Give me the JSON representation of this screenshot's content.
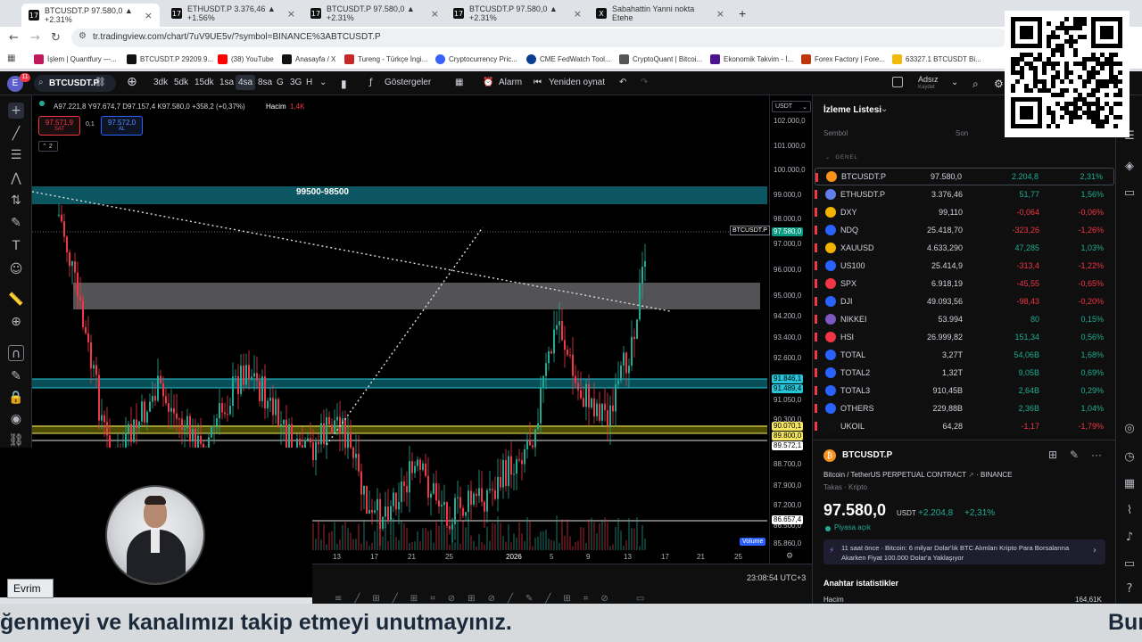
{
  "browser": {
    "tabs": [
      {
        "label": "BTCUSDT.P 97.580,0 ▲ +2.31%",
        "active": true
      },
      {
        "label": "ETHUSDT.P 3.376,46 ▲ +1.56%",
        "active": false
      },
      {
        "label": "BTCUSDT.P 97.580,0 ▲ +2.31%",
        "active": false
      },
      {
        "label": "BTCUSDT.P 97.580,0 ▲ +2.31%",
        "active": false
      },
      {
        "label": "Sabahattin Yanni nokta Etehe",
        "active": false
      }
    ],
    "url": "tr.tradingview.com/chart/7uV9UE5v/?symbol=BINANCE%3ABTCUSDT.P",
    "bookmarks": [
      "İşlem | Quantfury —...",
      "BTCUSDT.P 29209.9...",
      "(38) YouTube",
      "Anasayfa / X",
      "Tureng - Türkçe İngi...",
      "Cryptocurrency Pric...",
      "CME FedWatch Tool...",
      "CryptoQuant | Bitcoi...",
      "Ekonomik Takvim - İ...",
      "Forex Factory | Fore...",
      "63327.1 BTCUSDT Bi..."
    ]
  },
  "toolbar": {
    "symbol": "BTCUSDT.P",
    "intervals": [
      "3dk",
      "5dk",
      "15dk",
      "1sa",
      "4sa",
      "8sa",
      "G",
      "3G",
      "H"
    ],
    "active_interval": "4sa",
    "indicators": "Göstergeler",
    "alert": "Alarm",
    "replay": "Yeniden oynat",
    "user": "Adsız",
    "saved": "Kaydet",
    "avatar": "E",
    "badge": "11"
  },
  "legend": {
    "ohlc": "A97.221,8 Y97.674,7 D97.157,4 K97.580,0 +358,2 (+0,37%)",
    "volume_label": "Hacim",
    "volume_value": "1,4K",
    "sell_price": "97.571,9",
    "sell_label": "SAT",
    "spread": "0,1",
    "buy_price": "97.572,0",
    "buy_label": "AL",
    "collapse_count": "2"
  },
  "chart": {
    "zone_label": "99500-98500",
    "volume_tag": "Volume",
    "currency": "USDT",
    "price_labels": [
      "102.000,0",
      "101.000,0",
      "100.000,0",
      "99.000,0",
      "98.000,0",
      "97.000,0",
      "96.000,0",
      "95.000,0",
      "94.200,0",
      "93.400,0",
      "92.600,0",
      "91.050,0",
      "90.300,0",
      "88.700,0",
      "87.900,0",
      "87.200,0",
      "86.500,0",
      "85.860,0"
    ],
    "tags": {
      "symbol": "BTCUSDT.P",
      "last": "97.580,0",
      "a": "91.846,1",
      "b": "91.489,4",
      "c": "90.070,1",
      "d": "89.800,0",
      "e": "89.572,1",
      "f": "86.657,4"
    },
    "time_labels": [
      "13",
      "17",
      "21",
      "25",
      "2026",
      "5",
      "9",
      "13",
      "17",
      "21",
      "25"
    ],
    "clock": "23:08:54 UTC+3"
  },
  "webcam": {
    "name": "Evrim"
  },
  "watchlist": {
    "title": "İzleme Listesi",
    "col_symbol": "Sembol",
    "col_last": "Son",
    "section": "GENEL",
    "rows": [
      {
        "sym": "BTCUSDT.P",
        "last": "97.580,0",
        "chg": "2.204,8",
        "pct": "2,31%",
        "dir": "pos",
        "color": "#f7931a"
      },
      {
        "sym": "ETHUSDT.P",
        "last": "3.376,46",
        "chg": "51,77",
        "pct": "1,56%",
        "dir": "pos",
        "color": "#627eea"
      },
      {
        "sym": "DXY",
        "last": "99,110",
        "chg": "-0,064",
        "pct": "-0,06%",
        "dir": "neg",
        "color": "#f5b400"
      },
      {
        "sym": "NDQ",
        "last": "25.418,70",
        "chg": "-323,26",
        "pct": "-1,26%",
        "dir": "neg",
        "color": "#2962ff"
      },
      {
        "sym": "XAUUSD",
        "last": "4.633,290",
        "chg": "47,285",
        "pct": "1,03%",
        "dir": "pos",
        "color": "#f5b400"
      },
      {
        "sym": "US100",
        "last": "25.414,9",
        "chg": "-313,4",
        "pct": "-1,22%",
        "dir": "neg",
        "color": "#2962ff"
      },
      {
        "sym": "SPX",
        "last": "6.918,19",
        "chg": "-45,55",
        "pct": "-0,65%",
        "dir": "neg",
        "color": "#f23645"
      },
      {
        "sym": "DJI",
        "last": "49.093,56",
        "chg": "-98,43",
        "pct": "-0,20%",
        "dir": "neg",
        "color": "#2962ff"
      },
      {
        "sym": "NIKKEI",
        "last": "53.994",
        "chg": "80",
        "pct": "0,15%",
        "dir": "pos",
        "color": "#7e57c2"
      },
      {
        "sym": "HSI",
        "last": "26.999,82",
        "chg": "151,34",
        "pct": "0,56%",
        "dir": "pos",
        "color": "#f23645"
      },
      {
        "sym": "TOTAL",
        "last": "3,27T",
        "chg": "54,06B",
        "pct": "1,68%",
        "dir": "pos",
        "color": "#2962ff"
      },
      {
        "sym": "TOTAL2",
        "last": "1,32T",
        "chg": "9,05B",
        "pct": "0,69%",
        "dir": "pos",
        "color": "#2962ff"
      },
      {
        "sym": "TOTAL3",
        "last": "910,45B",
        "chg": "2,64B",
        "pct": "0,29%",
        "dir": "pos",
        "color": "#2962ff"
      },
      {
        "sym": "OTHERS",
        "last": "229,88B",
        "chg": "2,36B",
        "pct": "1,04%",
        "dir": "pos",
        "color": "#2962ff"
      },
      {
        "sym": "UKOIL",
        "last": "64,28",
        "chg": "-1,17",
        "pct": "-1,79%",
        "dir": "neg",
        "color": "#111111"
      }
    ]
  },
  "details": {
    "symbol": "BTCUSDT.P",
    "desc": "Bitcoin / TetherUS PERPETUAL CONTRACT",
    "exchange": "BINANCE",
    "type": "Takas · Kripto",
    "price": "97.580,0",
    "currency": "USDT",
    "change": "+2.204,8",
    "change_pct": "+2,31%",
    "market": "Piyasa açık",
    "news": "11 saat önce · Bitcoin: 6 milyar Dolar'lık BTC Alımları Kripto Para Borsalarına Akarken Fiyat 100.000 Dolar'a Yaklaşıyor",
    "stats_title": "Anahtar istatistikler",
    "volume_label": "Hacim",
    "volume_value": "164,61K"
  },
  "caption": {
    "left": "ğenmeyi ve kanalımızı takip etmeyi unutmayınız.",
    "right": "Bur"
  },
  "candles": {
    "seed": 7
  }
}
